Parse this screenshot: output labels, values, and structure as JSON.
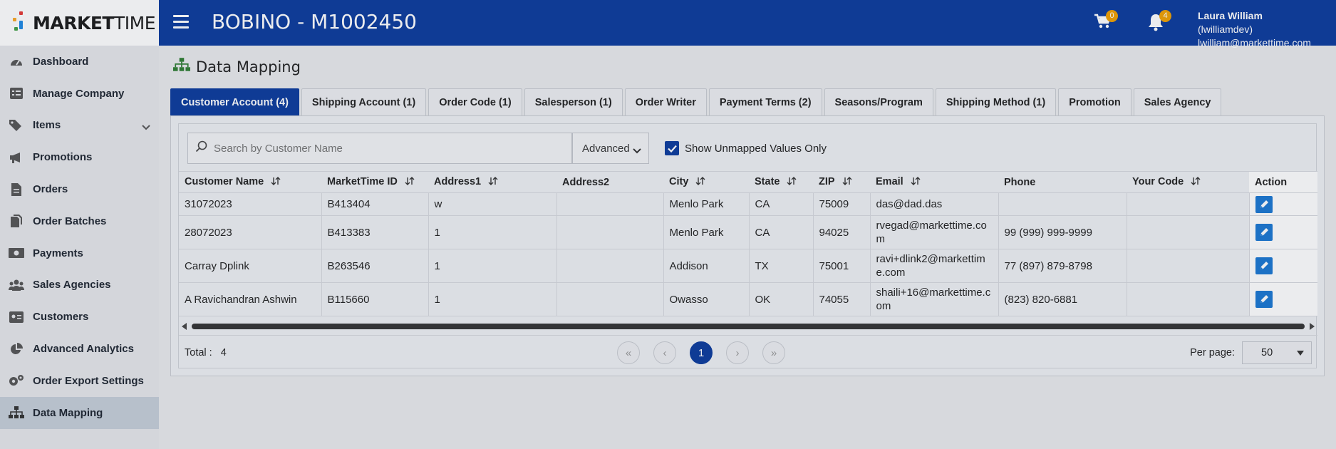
{
  "brand": {
    "logo_bold": "MARKET",
    "logo_light": "TIME"
  },
  "header": {
    "title": "BOBINO - M1002450",
    "cart_count": "0",
    "notif_count": "4",
    "user_name": "Laura William",
    "user_handle": "(lwilliamdev)",
    "user_email": "lwilliam@markettime.com"
  },
  "sidebar": {
    "items": [
      {
        "label": "Dashboard",
        "icon": "gauge-icon"
      },
      {
        "label": "Manage Company",
        "icon": "list-icon"
      },
      {
        "label": "Items",
        "icon": "tags-icon"
      },
      {
        "label": "Promotions",
        "icon": "megaphone-icon"
      },
      {
        "label": "Orders",
        "icon": "file-icon"
      },
      {
        "label": "Order Batches",
        "icon": "files-icon"
      },
      {
        "label": "Payments",
        "icon": "money-icon"
      },
      {
        "label": "Sales Agencies",
        "icon": "users-icon"
      },
      {
        "label": "Customers",
        "icon": "id-card-icon"
      },
      {
        "label": "Advanced Analytics",
        "icon": "pie-chart-icon"
      },
      {
        "label": "Order Export Settings",
        "icon": "gears-icon"
      },
      {
        "label": "Data Mapping",
        "icon": "sitemap-icon"
      }
    ],
    "active": "Data Mapping"
  },
  "page": {
    "title": "Data Mapping"
  },
  "tabs": [
    "Customer Account (4)",
    "Shipping Account (1)",
    "Order Code (1)",
    "Salesperson (1)",
    "Order Writer",
    "Payment Terms (2)",
    "Seasons/Program",
    "Shipping Method (1)",
    "Promotion",
    "Sales Agency"
  ],
  "filters": {
    "search_placeholder": "Search by Customer Name",
    "advanced_label": "Advanced",
    "show_unmapped_label": "Show Unmapped Values Only",
    "show_unmapped_checked": true
  },
  "table": {
    "columns": [
      "Customer Name",
      "MarketTime ID",
      "Address1",
      "Address2",
      "City",
      "State",
      "ZIP",
      "Email",
      "Phone",
      "Your Code",
      "Action"
    ],
    "rows": [
      [
        "31072023",
        "B413404",
        "w",
        "",
        "Menlo Park",
        "CA",
        "75009",
        "das@dad.das",
        "",
        ""
      ],
      [
        "28072023",
        "B413383",
        "1",
        "",
        "Menlo Park",
        "CA",
        "94025",
        "rvegad@markettime.com",
        "99 (999) 999-9999",
        ""
      ],
      [
        "Carray Dplink",
        "B263546",
        "1",
        "",
        "Addison",
        "TX",
        "75001",
        "ravi+dlink2@markettime.com",
        "77 (897) 879-8798",
        ""
      ],
      [
        "A Ravichandran Ashwin",
        "B115660",
        "1",
        "",
        "Owasso",
        "OK",
        "74055",
        "shaili+16@markettime.com",
        "(823) 820-6881",
        ""
      ]
    ]
  },
  "footer": {
    "total_label": "Total :",
    "total_value": "4",
    "current_page": "1",
    "per_page_label": "Per page:",
    "per_page_value": "50"
  },
  "colors": {
    "primary": "#0b3a9c",
    "edit": "#1976d2",
    "badge": "#f0a000"
  }
}
